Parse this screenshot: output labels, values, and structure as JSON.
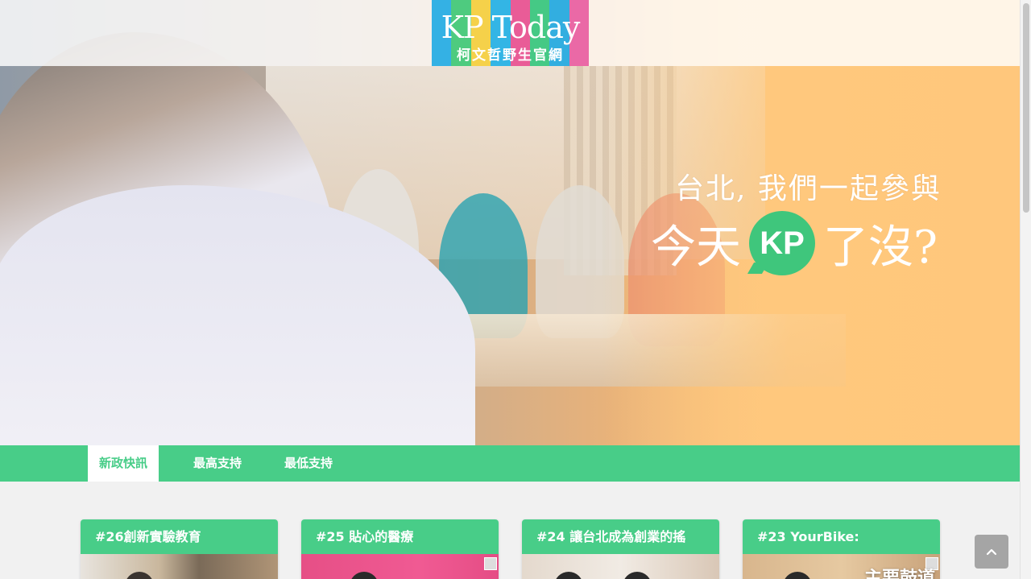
{
  "logo": {
    "title": "KP Today",
    "subtitle": "柯文哲野生官網",
    "stripe_colors": [
      "#34b1e4",
      "#4ecb7f",
      "#f5d14a",
      "#33b5e5",
      "#e95c97",
      "#45c985",
      "#32aee0",
      "#ea69a6"
    ]
  },
  "hero": {
    "tagline_line1": "台北, 我們一起參與",
    "tagline_pre": "今天",
    "tagline_badge": "KP",
    "tagline_post": "了沒?"
  },
  "tabs": [
    {
      "label": "新政快訊",
      "active": true
    },
    {
      "label": "最高支持",
      "active": false
    },
    {
      "label": "最低支持",
      "active": false
    }
  ],
  "cards": [
    {
      "title": "#26創新實驗教育"
    },
    {
      "title": "#25 貼心的醫療"
    },
    {
      "title": "#24 讓台北成為創業的搖"
    },
    {
      "title": "#23 YourBike:",
      "overlay": "主要鼓道"
    }
  ],
  "colors": {
    "accent": "#48cd88",
    "hero_orange": "#ffc77c",
    "back_to_top": "#a5a5a5"
  },
  "icons": {
    "back_to_top": "chevron-up-icon"
  }
}
